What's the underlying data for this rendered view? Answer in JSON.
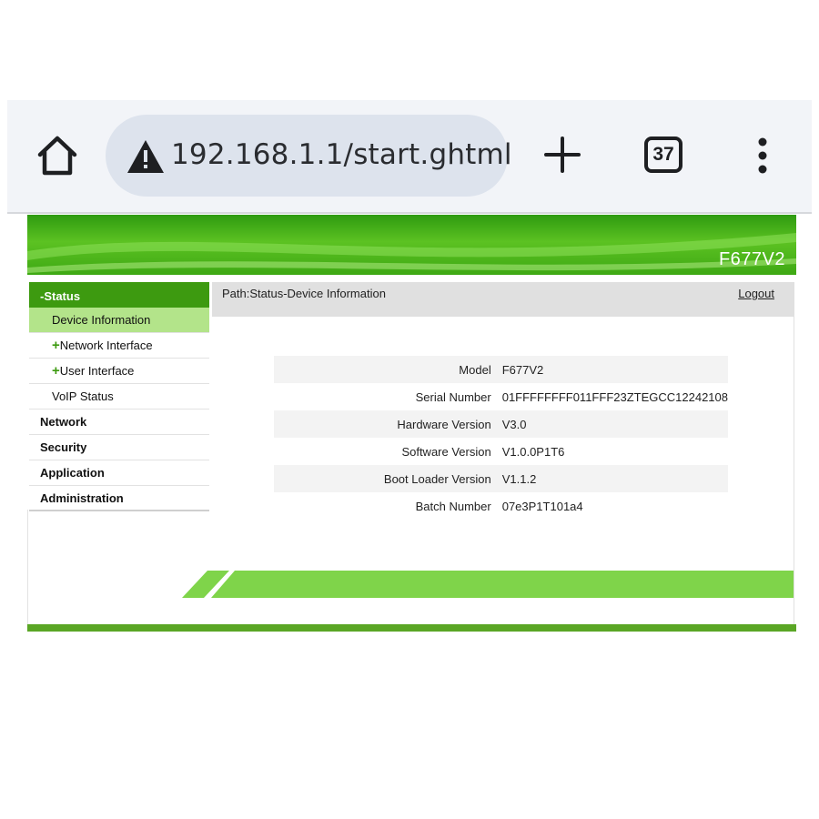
{
  "browser": {
    "url": "192.168.1.1/start.ghtml",
    "tab_count": "37",
    "icons": [
      "home-icon",
      "warning-icon",
      "new-tab-plus-icon",
      "tab-switcher-icon",
      "more-menu-icon"
    ]
  },
  "router": {
    "model_banner": "F677V2",
    "path": "Path:Status-Device Information",
    "logout": "Logout",
    "sidebar": {
      "status": "-Status",
      "status_items": [
        {
          "label": "Device Information",
          "prefix": ""
        },
        {
          "label": "Network Interface",
          "prefix": "+"
        },
        {
          "label": "User Interface",
          "prefix": "+"
        },
        {
          "label": "VoIP Status",
          "prefix": ""
        }
      ],
      "top_items": [
        "Network",
        "Security",
        "Application",
        "Administration"
      ]
    },
    "device_info": [
      {
        "label": "Model",
        "value": "F677V2"
      },
      {
        "label": "Serial Number",
        "value": "01FFFFFFFF011FFF23ZTEGCC12242108"
      },
      {
        "label": "Hardware Version",
        "value": "V3.0"
      },
      {
        "label": "Software Version",
        "value": "V1.0.0P1T6"
      },
      {
        "label": "Boot Loader Version",
        "value": "V1.1.2"
      },
      {
        "label": "Batch Number",
        "value": "07e3P1T101a4"
      }
    ]
  },
  "colors": {
    "brand_green": "#3d9a10",
    "active_item": "#b3e48a",
    "band_green": "#7fd44a"
  }
}
